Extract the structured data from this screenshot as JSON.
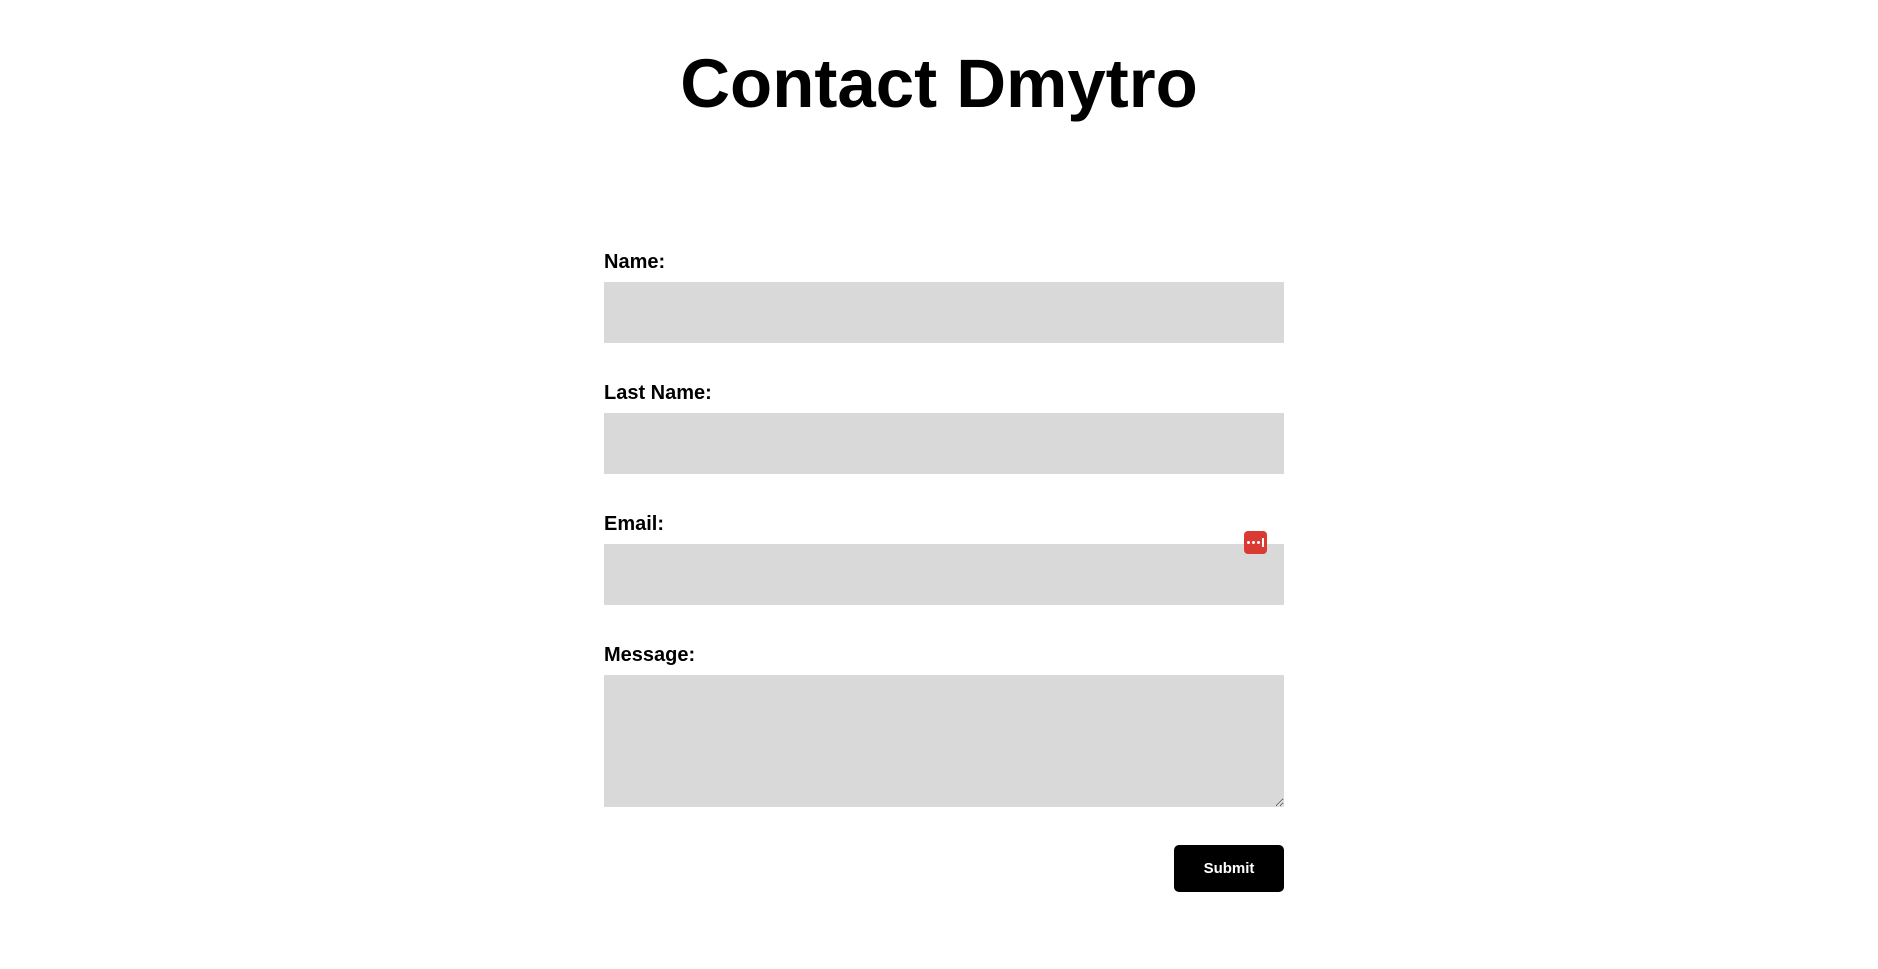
{
  "page": {
    "title": "Contact Dmytro"
  },
  "form": {
    "name_label": "Name:",
    "name_value": "",
    "last_name_label": "Last Name:",
    "last_name_value": "",
    "email_label": "Email:",
    "email_value": "",
    "message_label": "Message:",
    "message_value": "",
    "submit_label": "Submit"
  },
  "icons": {
    "password_manager": "password-manager-icon"
  },
  "colors": {
    "input_background": "#d9d9d9",
    "button_background": "#000000",
    "button_text": "#ffffff",
    "password_manager_icon": "#d93a34"
  }
}
